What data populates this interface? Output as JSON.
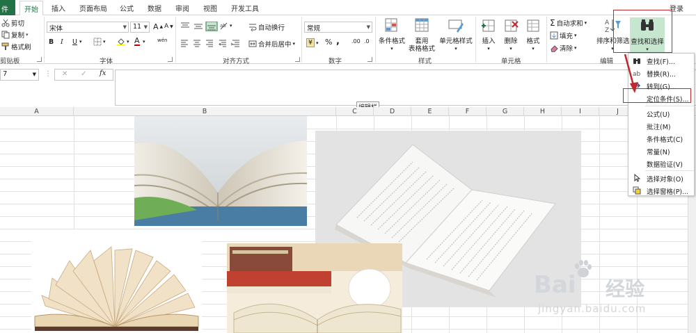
{
  "tabs": {
    "file": "件",
    "home": "开始",
    "insert": "插入",
    "layout": "页面布局",
    "formulas": "公式",
    "data": "数据",
    "review": "审阅",
    "view": "视图",
    "developer": "开发工具",
    "login": "登录"
  },
  "clipboard": {
    "cut": "剪切",
    "copy": "复制",
    "painter": "格式刷",
    "title": "剪贴板"
  },
  "font": {
    "name": "宋体",
    "size": "11",
    "bold": "B",
    "italic": "I",
    "underline": "U",
    "grow": "A",
    "shrink": "A",
    "color_glyph": "A",
    "phonetic": "wén",
    "title": "字体"
  },
  "alignment": {
    "wrap": "自动换行",
    "merge": "合并后居中",
    "title": "对齐方式"
  },
  "number": {
    "format": "常规",
    "currency": "¥",
    "percent": "%",
    "comma": ",",
    "inc": ".00",
    "dec": ".0",
    "title": "数字"
  },
  "styles": {
    "cond": "条件格式",
    "table_l1": "套用",
    "table_l2": "表格格式",
    "cell_styles": "单元格样式",
    "title": "样式"
  },
  "cells": {
    "insert": "插入",
    "delete": "删除",
    "format": "格式",
    "title": "单元格"
  },
  "editing": {
    "autosum": "自动求和",
    "fill": "填充",
    "clear": "清除",
    "sort": "排序和筛选",
    "find": "查找和选择",
    "title": "编辑"
  },
  "formula_bar": {
    "namebox": "7",
    "cancel": "✕",
    "enter": "✓",
    "fx": "fx",
    "tooltip": "编辑栏"
  },
  "columns": [
    "A",
    "B",
    "C",
    "D",
    "E",
    "F",
    "G",
    "H",
    "I",
    "J"
  ],
  "menu": {
    "items": [
      {
        "label": "查找(F)...",
        "icon": "binoculars-icon"
      },
      {
        "label": "替换(R)...",
        "icon": "replace-icon"
      },
      {
        "label": "转到(G)...",
        "icon": "arrow-right-icon"
      },
      {
        "label": "定位条件(S)...",
        "icon": "none"
      },
      {
        "label": "公式(U)",
        "icon": "none"
      },
      {
        "label": "批注(M)",
        "icon": "none"
      },
      {
        "label": "条件格式(C)",
        "icon": "none"
      },
      {
        "label": "常量(N)",
        "icon": "none"
      },
      {
        "label": "数据验证(V)",
        "icon": "none"
      },
      {
        "label": "选择对象(O)",
        "icon": "cursor-icon"
      },
      {
        "label": "选择窗格(P)...",
        "icon": "pane-icon"
      }
    ]
  },
  "watermark": {
    "brand": "Bai",
    "brand2": "经验",
    "url": "jingyan.baidu.com"
  },
  "colors": {
    "excel_green": "#217346",
    "highlight_red": "#c0282d",
    "selected_btn": "#c6e6cf"
  }
}
